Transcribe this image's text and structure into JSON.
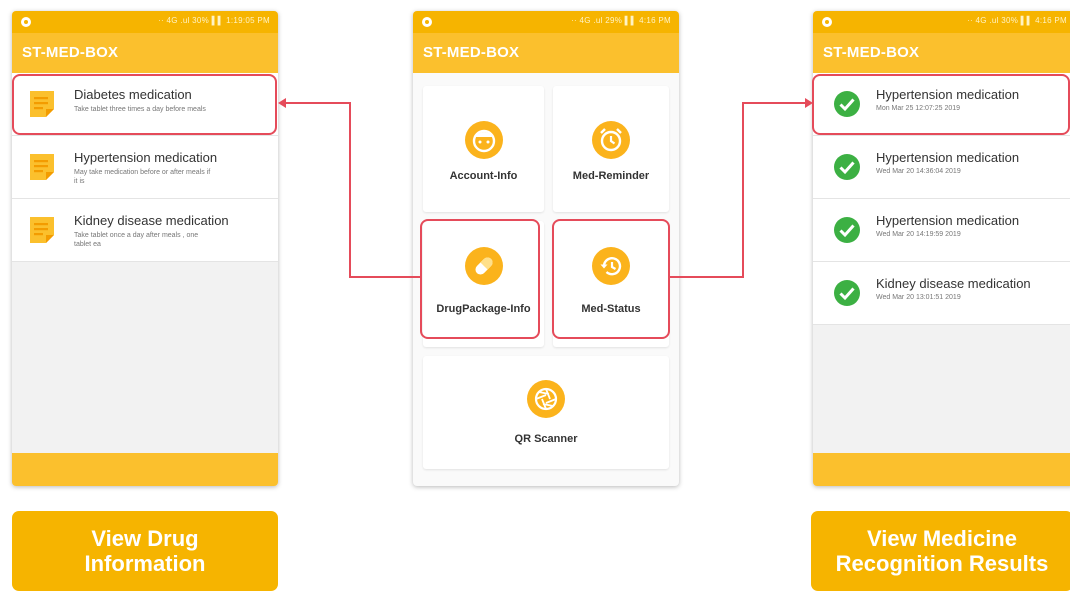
{
  "status_bar": {
    "left_text": "·· 4G .ul 30% ▌▌ 1:19:05 PM",
    "center_text": "·· 4G .ul 29% ▌▌ 4:16 PM",
    "right_text": "·· 4G .ul 30% ▌▌ 4:16 PM"
  },
  "app_title": "ST-MED-BOX",
  "left_screen": {
    "items": [
      {
        "name": "Diabetes medication",
        "desc": "Take tablet three times a day before meals",
        "icon": "note-icon"
      },
      {
        "name": "Hypertension medication",
        "desc": "May take medication before or after meals if it is",
        "icon": "note-icon"
      },
      {
        "name": "Kidney disease medication",
        "desc": "Take tablet once a day after meals , one tablet ea",
        "icon": "note-icon"
      }
    ]
  },
  "center_screen": {
    "tiles": [
      {
        "label": "Account-Info",
        "icon": "face-icon"
      },
      {
        "label": "Med-Reminder",
        "icon": "alarm-clock-icon"
      },
      {
        "label": "DrugPackage-Info",
        "icon": "pill-icon"
      },
      {
        "label": "Med-Status",
        "icon": "history-icon"
      },
      {
        "label": "QR Scanner",
        "icon": "aperture-icon"
      }
    ]
  },
  "right_screen": {
    "items": [
      {
        "name": "Hypertension medication",
        "time": "Mon Mar 25 12:07:25 2019",
        "icon": "check-icon"
      },
      {
        "name": "Hypertension medication",
        "time": "Wed Mar 20 14:36:04 2019",
        "icon": "check-icon"
      },
      {
        "name": "Hypertension medication",
        "time": "Wed Mar 20 14:19:59 2019",
        "icon": "check-icon"
      },
      {
        "name": "Kidney disease medication",
        "time": "Wed Mar 20 13:01:51 2019",
        "icon": "check-icon"
      }
    ]
  },
  "captions": {
    "left": [
      "View Drug",
      "Information"
    ],
    "right": [
      "View Medicine",
      "Recognition Results"
    ]
  },
  "colors": {
    "primary": "#fbc02d",
    "status_bar": "#f6b400",
    "icon_orange": "#fbb31c",
    "highlight": "#e54b5a",
    "check_green": "#3cb043"
  }
}
